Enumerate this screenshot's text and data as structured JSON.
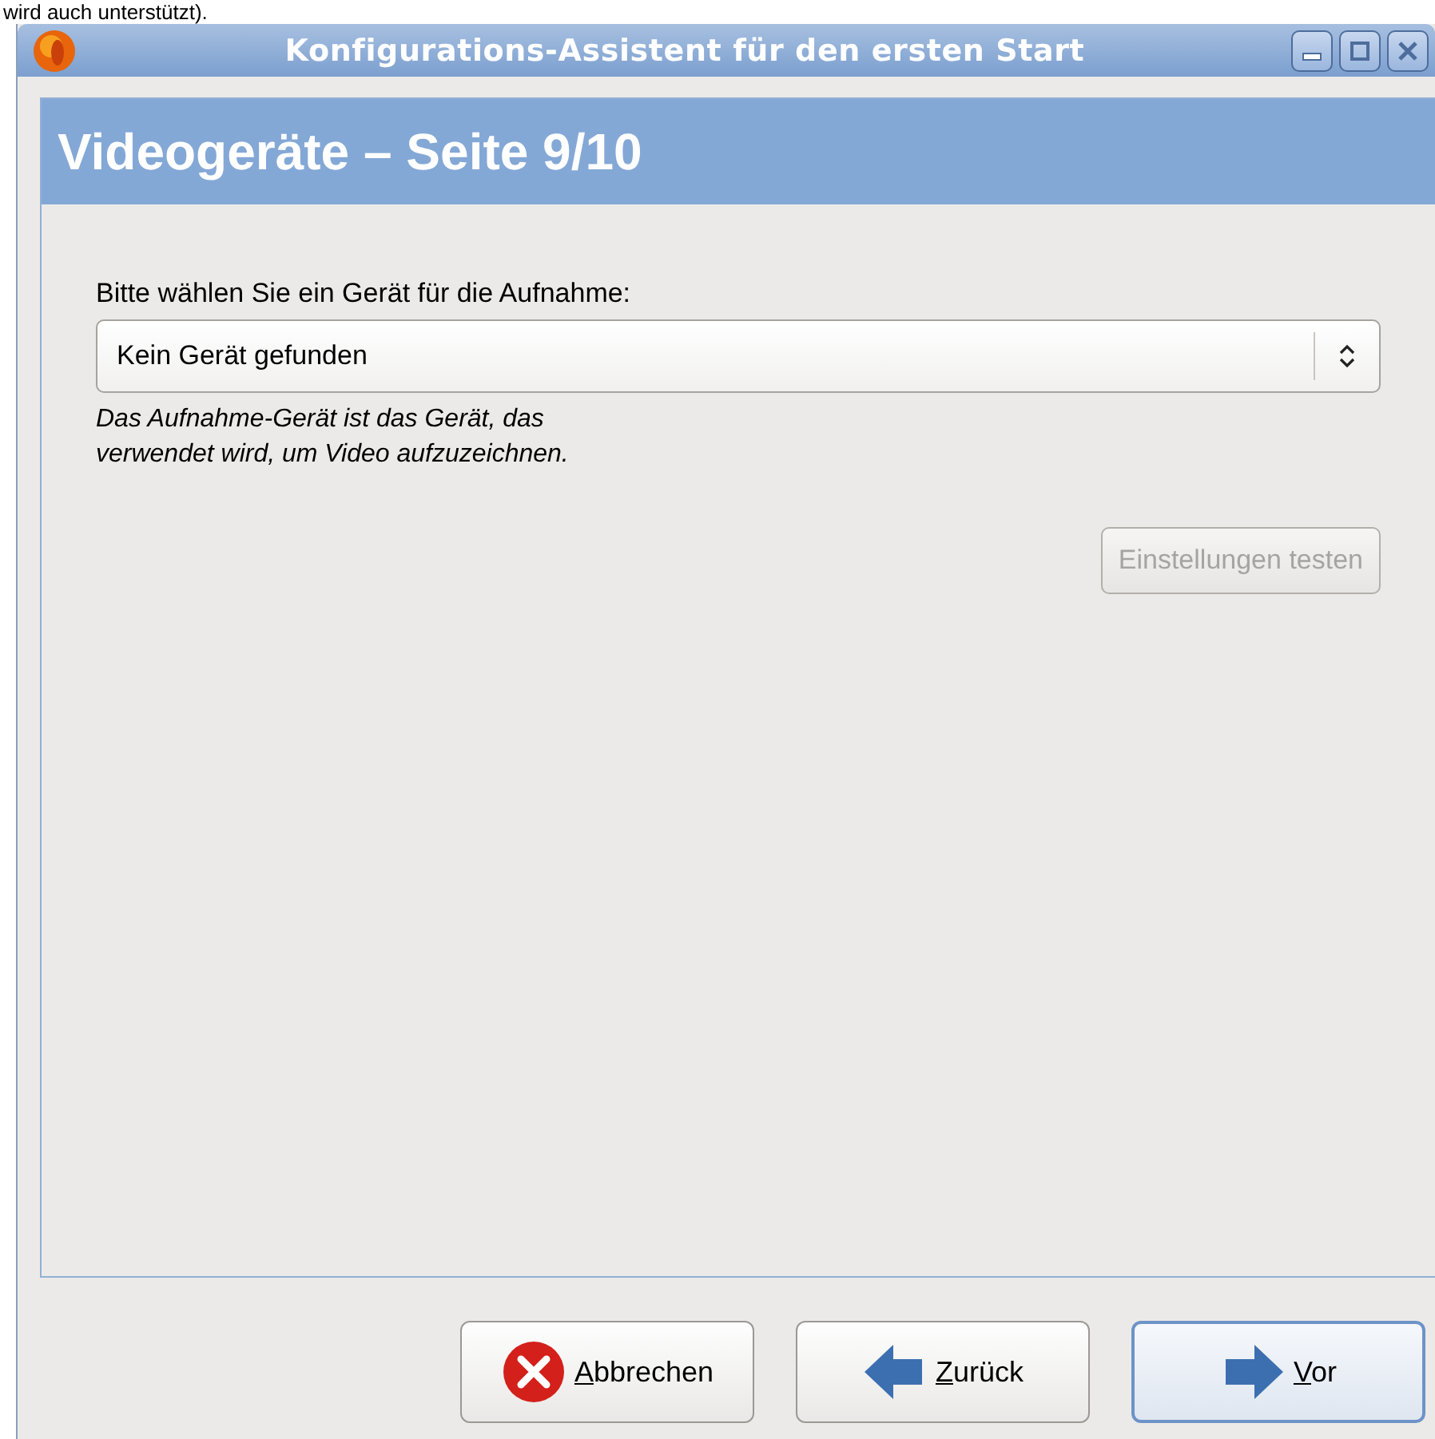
{
  "above_window_text": "wird auch unterstützt).",
  "window": {
    "title": "Konfigurations-Assistent für den ersten Start"
  },
  "page": {
    "heading": "Videogeräte – Seite 9/10",
    "device_label": "Bitte wählen Sie ein Gerät für die Aufnahme:",
    "device_select": {
      "value": "Kein Gerät gefunden"
    },
    "hint": "Das Aufnahme-Gerät ist das Gerät, das\nverwendet wird, um Video aufzuzeichnen.",
    "test_button": {
      "label": "Einstellungen testen",
      "disabled": true
    }
  },
  "buttons": [
    {
      "kind": "cancel",
      "label": "Abbrechen",
      "mnemonic_underlined": true,
      "default": false
    },
    {
      "kind": "back",
      "label": "Zurück",
      "mnemonic_underlined": true,
      "default": false
    },
    {
      "kind": "next",
      "label": "Vor",
      "mnemonic_underlined": true,
      "default": true
    }
  ]
}
